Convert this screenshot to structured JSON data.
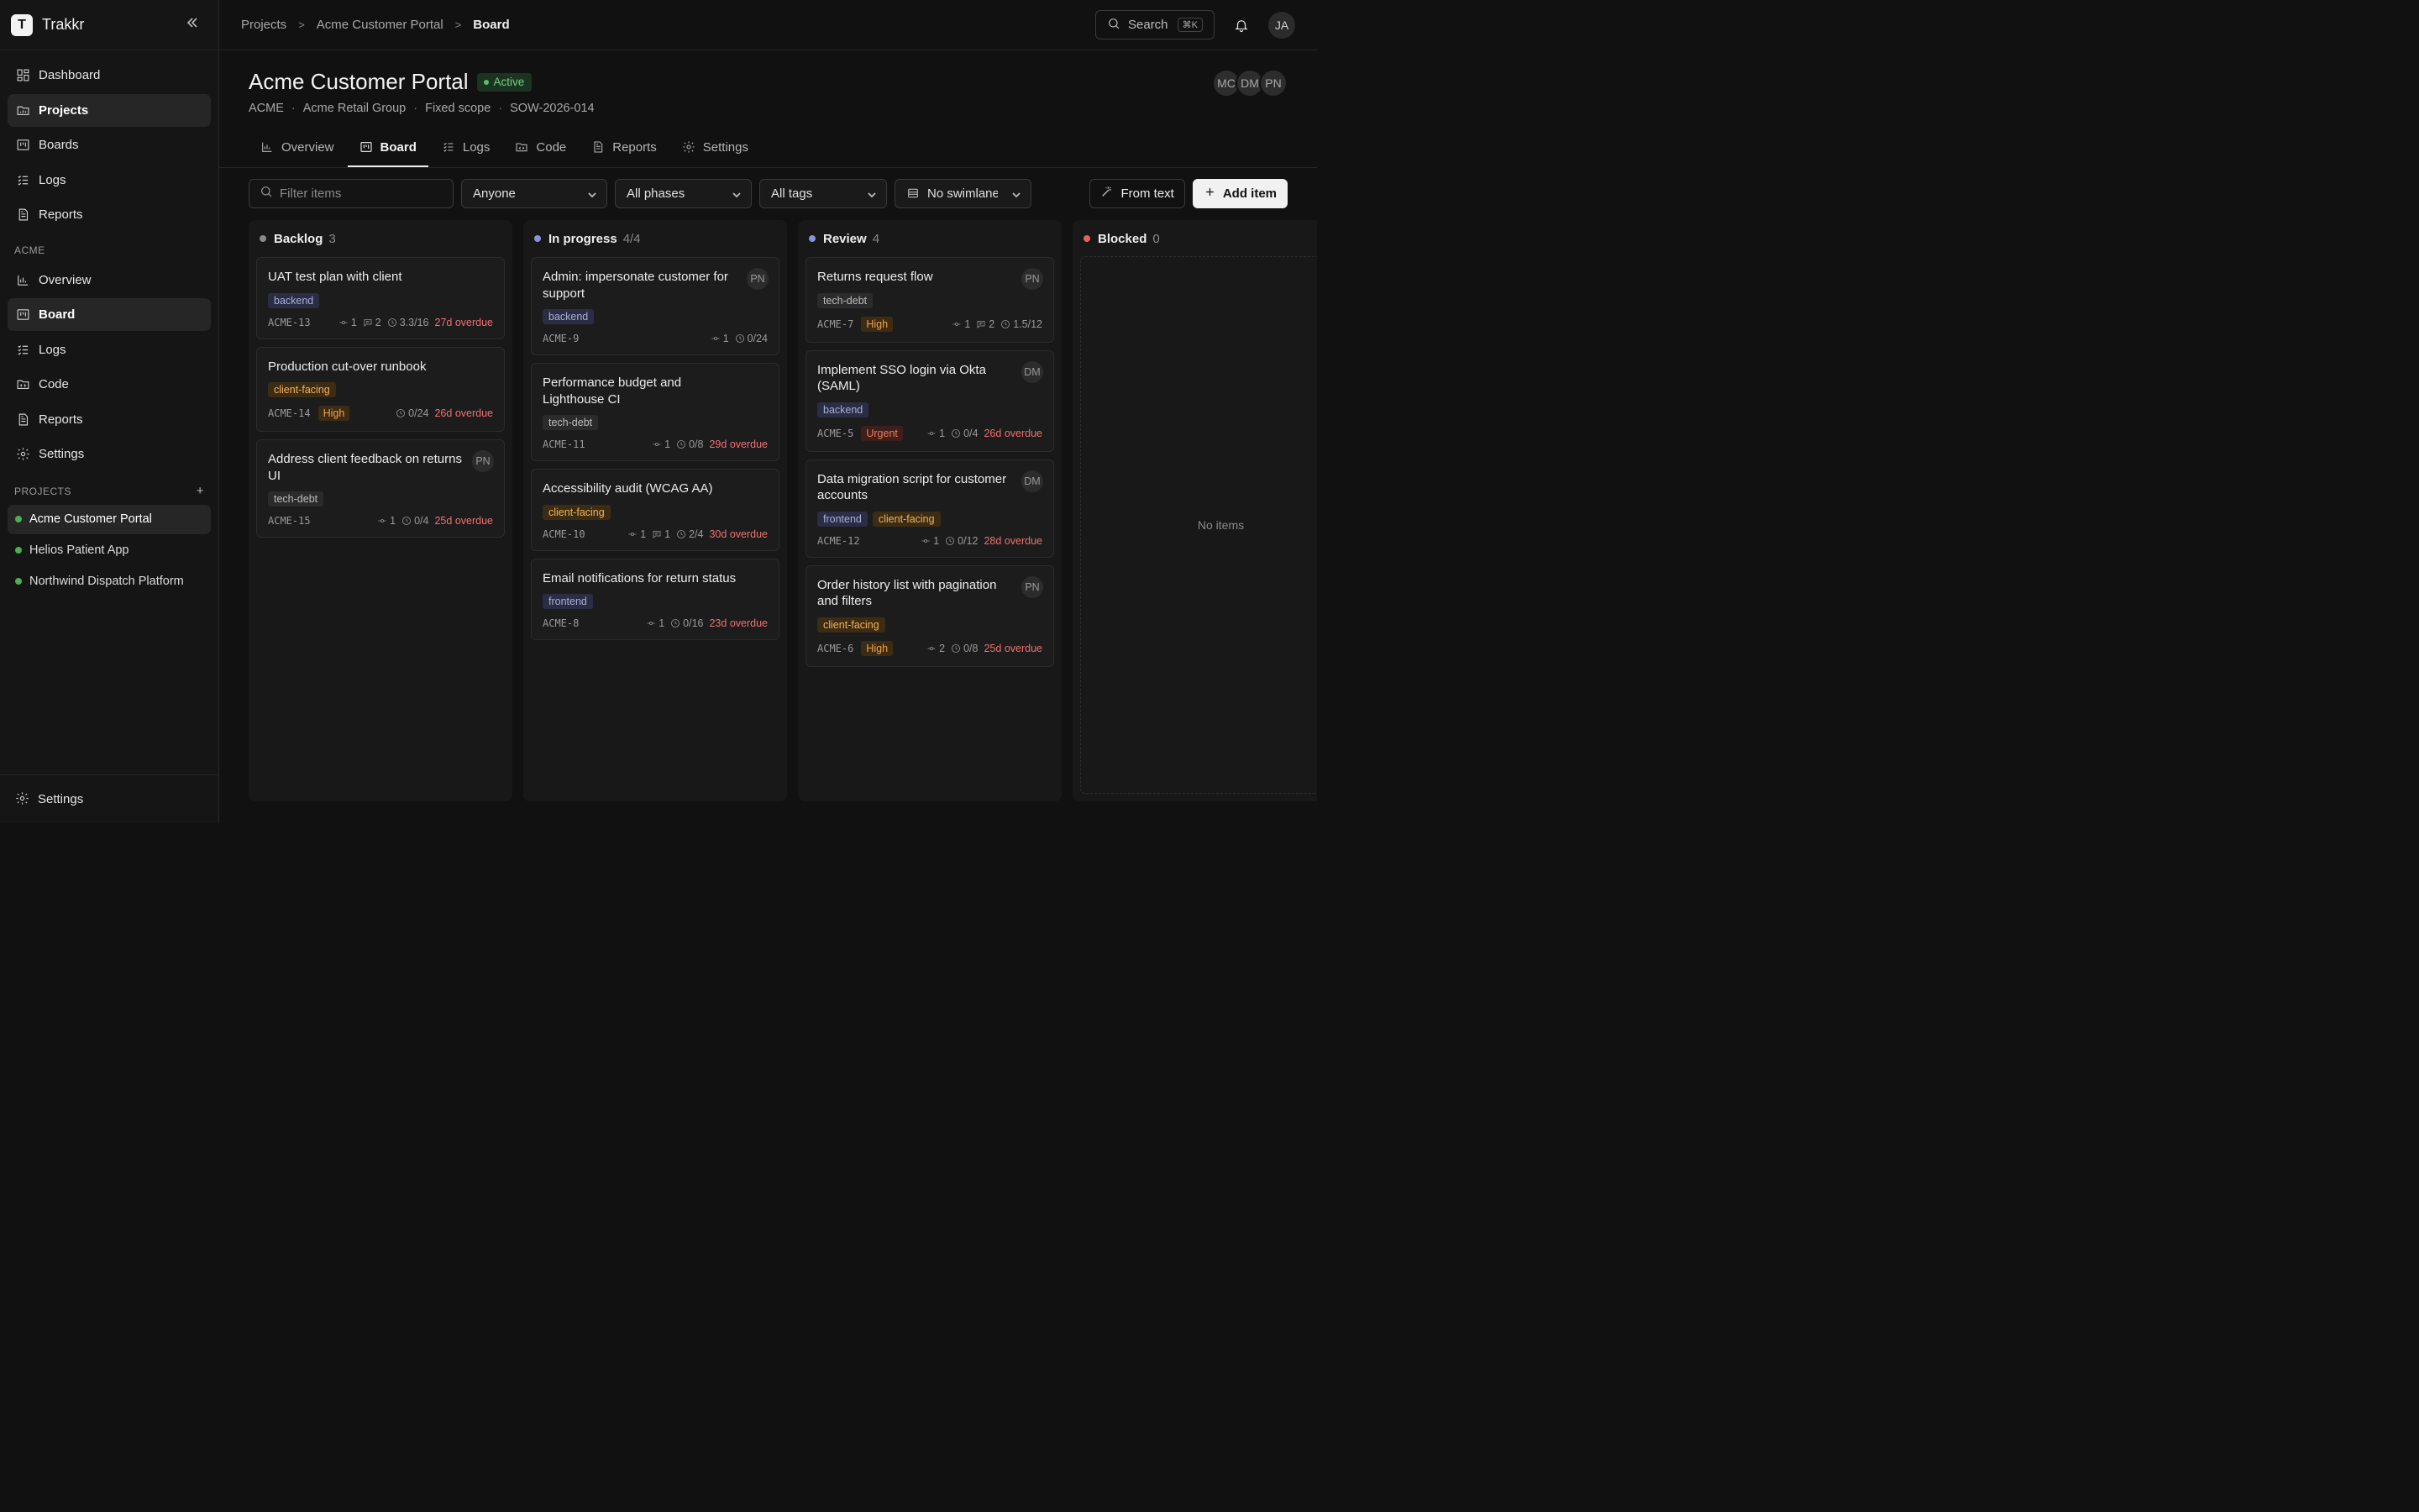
{
  "app": {
    "name": "Trakkr",
    "logo_letter": "T"
  },
  "sidebar": {
    "main_nav": [
      {
        "label": "Dashboard",
        "icon": "dashboard-icon",
        "active": false
      },
      {
        "label": "Projects",
        "icon": "projects-icon",
        "active": true
      },
      {
        "label": "Boards",
        "icon": "boards-icon",
        "active": false
      },
      {
        "label": "Logs",
        "icon": "logs-icon",
        "active": false
      },
      {
        "label": "Reports",
        "icon": "reports-icon",
        "active": false
      }
    ],
    "workspace_label": "ACME",
    "workspace_nav": [
      {
        "label": "Overview",
        "icon": "overview-icon",
        "active": false
      },
      {
        "label": "Board",
        "icon": "board-icon",
        "active": true
      },
      {
        "label": "Logs",
        "icon": "logs-icon",
        "active": false
      },
      {
        "label": "Code",
        "icon": "code-icon",
        "active": false
      },
      {
        "label": "Reports",
        "icon": "reports-icon",
        "active": false
      },
      {
        "label": "Settings",
        "icon": "gear-icon",
        "active": false
      }
    ],
    "projects_label": "PROJECTS",
    "projects_add": "+",
    "projects": [
      {
        "label": "Acme Customer Portal",
        "active": true
      },
      {
        "label": "Helios Patient App",
        "active": false
      },
      {
        "label": "Northwind Dispatch Platform",
        "active": false
      }
    ],
    "footer_label": "Settings"
  },
  "topbar": {
    "breadcrumb": [
      "Projects",
      "Acme Customer Portal",
      "Board"
    ],
    "search_label": "Search",
    "search_shortcut": "⌘K",
    "user_initials": "JA"
  },
  "project": {
    "title": "Acme Customer Portal",
    "status": "Active",
    "meta": [
      "ACME",
      "Acme Retail Group",
      "Fixed scope",
      "SOW-2026-014"
    ],
    "members": [
      "MC",
      "DM",
      "PN"
    ],
    "tabs": [
      {
        "label": "Overview",
        "icon": "bar-chart-icon",
        "active": false
      },
      {
        "label": "Board",
        "icon": "kanban-icon",
        "active": true
      },
      {
        "label": "Logs",
        "icon": "checklist-icon",
        "active": false
      },
      {
        "label": "Code",
        "icon": "folder-code-icon",
        "active": false
      },
      {
        "label": "Reports",
        "icon": "document-icon",
        "active": false
      },
      {
        "label": "Settings",
        "icon": "gear-icon",
        "active": false
      }
    ]
  },
  "filters": {
    "search_placeholder": "Filter items",
    "assignee": "Anyone",
    "phase": "All phases",
    "tags": "All tags",
    "swimlane": "No swimlane",
    "from_text_label": "From text",
    "add_item_label": "Add item"
  },
  "columns": [
    {
      "name": "Backlog",
      "count": "3",
      "color": "#8a8a8a",
      "cards": [
        {
          "title": "UAT test plan with client",
          "tags": [
            "backend"
          ],
          "id": "ACME-13",
          "priority": "",
          "links": "1",
          "comments": "2",
          "time": "3.3/16",
          "overdue": "27d overdue",
          "assignee": ""
        },
        {
          "title": "Production cut-over runbook",
          "tags": [
            "client-facing"
          ],
          "id": "ACME-14",
          "priority": "High",
          "links": "",
          "comments": "",
          "time": "0/24",
          "overdue": "26d overdue",
          "assignee": ""
        },
        {
          "title": "Address client feedback on returns UI",
          "tags": [
            "tech-debt"
          ],
          "id": "ACME-15",
          "priority": "",
          "links": "1",
          "comments": "",
          "time": "0/4",
          "overdue": "25d overdue",
          "assignee": "PN"
        }
      ]
    },
    {
      "name": "In progress",
      "count": "4/4",
      "color": "#8b8fe0",
      "cards": [
        {
          "title": "Admin: impersonate customer for support",
          "tags": [
            "backend"
          ],
          "id": "ACME-9",
          "priority": "",
          "links": "1",
          "comments": "",
          "time": "0/24",
          "overdue": "",
          "assignee": "PN"
        },
        {
          "title": "Performance budget and Lighthouse CI",
          "tags": [
            "tech-debt"
          ],
          "id": "ACME-11",
          "priority": "",
          "links": "1",
          "comments": "",
          "time": "0/8",
          "overdue": "29d overdue",
          "assignee": ""
        },
        {
          "title": "Accessibility audit (WCAG AA)",
          "tags": [
            "client-facing"
          ],
          "id": "ACME-10",
          "priority": "",
          "links": "1",
          "comments": "1",
          "time": "2/4",
          "overdue": "30d overdue",
          "assignee": ""
        },
        {
          "title": "Email notifications for return status",
          "tags": [
            "frontend"
          ],
          "id": "ACME-8",
          "priority": "",
          "links": "1",
          "comments": "",
          "time": "0/16",
          "overdue": "23d overdue",
          "assignee": ""
        }
      ]
    },
    {
      "name": "Review",
      "count": "4",
      "color": "#8b8fe0",
      "cards": [
        {
          "title": "Returns request flow",
          "tags": [
            "tech-debt"
          ],
          "id": "ACME-7",
          "priority": "High",
          "links": "1",
          "comments": "2",
          "time": "1.5/12",
          "overdue": "",
          "assignee": "PN"
        },
        {
          "title": "Implement SSO login via Okta (SAML)",
          "tags": [
            "backend"
          ],
          "id": "ACME-5",
          "priority": "Urgent",
          "links": "1",
          "comments": "",
          "time": "0/4",
          "overdue": "26d overdue",
          "assignee": "DM"
        },
        {
          "title": "Data migration script for customer accounts",
          "tags": [
            "frontend",
            "client-facing"
          ],
          "id": "ACME-12",
          "priority": "",
          "links": "1",
          "comments": "",
          "time": "0/12",
          "overdue": "28d overdue",
          "assignee": "DM"
        },
        {
          "title": "Order history list with pagination and filters",
          "tags": [
            "client-facing"
          ],
          "id": "ACME-6",
          "priority": "High",
          "links": "2",
          "comments": "",
          "time": "0/8",
          "overdue": "25d overdue",
          "assignee": "PN"
        }
      ]
    },
    {
      "name": "Blocked",
      "count": "0",
      "color": "#e86060",
      "cards": [],
      "empty_label": "No items"
    }
  ]
}
